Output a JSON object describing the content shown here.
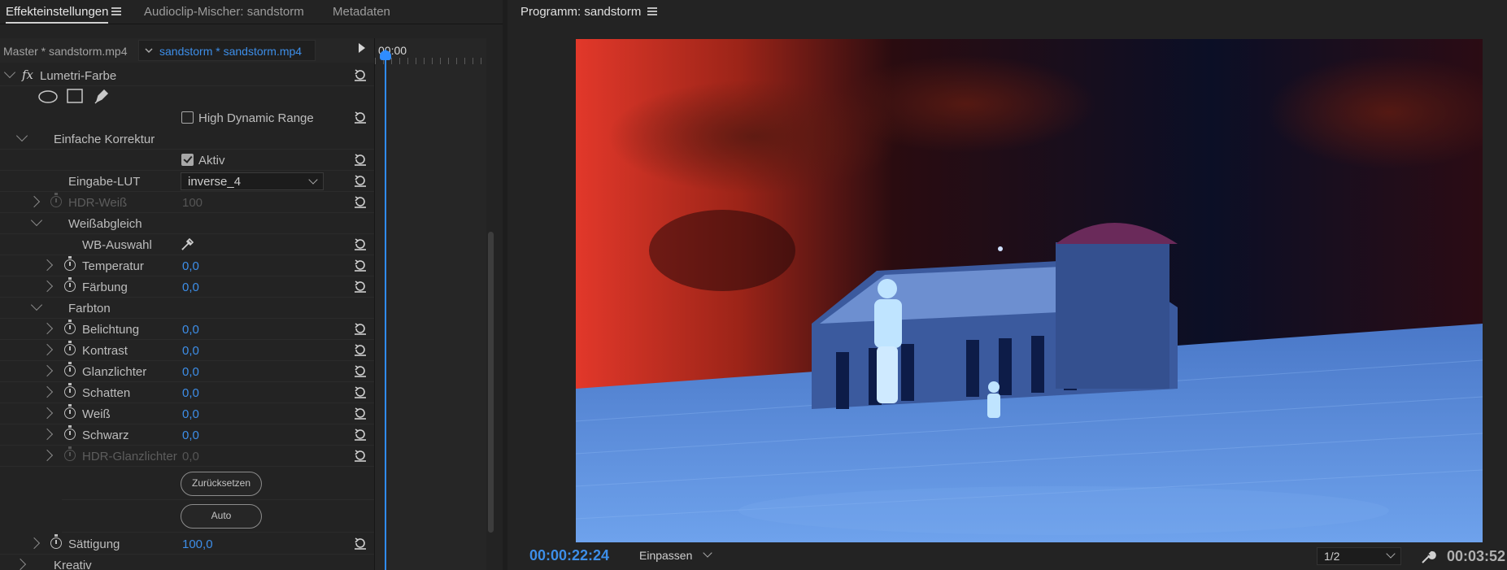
{
  "left_panel": {
    "tabs": [
      {
        "label": "Effekteinstellungen"
      },
      {
        "label": "Audioclip-Mischer: sandstorm"
      },
      {
        "label": "Metadaten"
      }
    ],
    "clip_master": "Master * sandstorm.mp4",
    "clip_sequence": "sandstorm * sandstorm.mp4",
    "timeline_start": "00:00"
  },
  "effect": {
    "name": "Lumetri-Farbe",
    "fx_symbol": "fx",
    "mask_tools": [
      "ellipse-mask-icon",
      "rectangle-mask-icon",
      "pen-mask-icon"
    ],
    "hdr_label": "High Dynamic Range",
    "basic_correction": "Einfache Korrektur",
    "active_label": "Aktiv",
    "input_lut_label": "Eingabe-LUT",
    "input_lut_value": "inverse_4",
    "hdr_white": {
      "label": "HDR-Weiß",
      "value": "100"
    },
    "white_balance": "Weißabgleich",
    "wb_picker": "WB-Auswahl",
    "temperature": {
      "label": "Temperatur",
      "value": "0,0"
    },
    "tint": {
      "label": "Färbung",
      "value": "0,0"
    },
    "tone": "Farbton",
    "exposure": {
      "label": "Belichtung",
      "value": "0,0"
    },
    "contrast": {
      "label": "Kontrast",
      "value": "0,0"
    },
    "highlights": {
      "label": "Glanzlichter",
      "value": "0,0"
    },
    "shadows": {
      "label": "Schatten",
      "value": "0,0"
    },
    "whites": {
      "label": "Weiß",
      "value": "0,0"
    },
    "blacks": {
      "label": "Schwarz",
      "value": "0,0"
    },
    "hdr_highlights": {
      "label": "HDR-Glanzlichter",
      "value": "0,0"
    },
    "reset_button": "Zurücksetzen",
    "auto_button": "Auto",
    "saturation": {
      "label": "Sättigung",
      "value": "100,0"
    },
    "creative": "Kreativ"
  },
  "program": {
    "title": "Programm: sandstorm",
    "current_timecode": "00:00:22:24",
    "fit": "Einpassen",
    "resolution": "1/2",
    "duration": "00:03:52"
  },
  "colors": {
    "accent_blue": "#3d8ee8",
    "playhead": "#2f8cff"
  }
}
